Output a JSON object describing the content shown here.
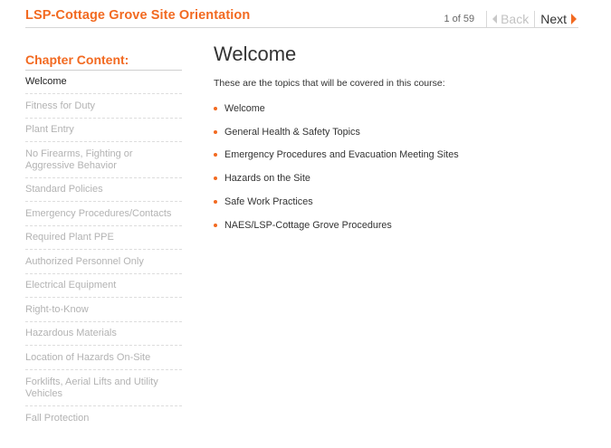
{
  "header": {
    "course_title": "LSP-Cottage Grove Site Orientation",
    "page_counter": "1 of 59",
    "back_label": "Back",
    "next_label": "Next"
  },
  "sidebar": {
    "heading": "Chapter Content:",
    "items": [
      {
        "label": "Welcome",
        "active": true
      },
      {
        "label": "Fitness for Duty",
        "active": false
      },
      {
        "label": "Plant Entry",
        "active": false
      },
      {
        "label": "No Firearms, Fighting or\nAggressive Behavior",
        "active": false
      },
      {
        "label": "Standard Policies",
        "active": false
      },
      {
        "label": "Emergency Procedures/Contacts",
        "active": false
      },
      {
        "label": "Required Plant PPE",
        "active": false
      },
      {
        "label": "Authorized Personnel Only",
        "active": false
      },
      {
        "label": "Electrical Equipment",
        "active": false
      },
      {
        "label": "Right-to-Know",
        "active": false
      },
      {
        "label": "Hazardous Materials",
        "active": false
      },
      {
        "label": "Location of Hazards On-Site",
        "active": false
      },
      {
        "label": "Forklifts, Aerial Lifts and Utility\nVehicles",
        "active": false
      },
      {
        "label": "Fall Protection",
        "active": false
      }
    ]
  },
  "main": {
    "heading": "Welcome",
    "intro": "These are the topics that will be covered in this course:",
    "topics": [
      "Welcome",
      "General Health & Safety Topics",
      "Emergency Procedures and Evacuation Meeting Sites",
      "Hazards on the Site",
      "Safe Work Practices",
      "NAES/LSP-Cottage Grove Procedures"
    ]
  },
  "colors": {
    "accent": "#f26a21",
    "inactive_text": "#b3b3b3",
    "active_text": "#222222",
    "divider": "#d6d6d6"
  }
}
